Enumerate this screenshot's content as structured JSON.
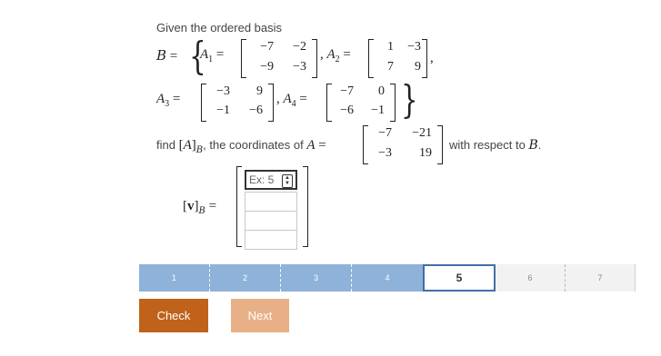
{
  "question": {
    "intro": "Given the ordered basis",
    "find_text": "find",
    "coords_text": ", the coordinates of",
    "wrt_text": "with respect to",
    "basis_symbol": "B",
    "matrices": {
      "A1": [
        [
          "−7",
          "−2"
        ],
        [
          "−9",
          "−3"
        ]
      ],
      "A2": [
        [
          "1",
          "−3"
        ],
        [
          "7",
          "9"
        ]
      ],
      "A3": [
        [
          "−3",
          "9"
        ],
        [
          "−1",
          "−6"
        ]
      ],
      "A4": [
        [
          "−7",
          "0"
        ],
        [
          "−6",
          "−1"
        ]
      ],
      "A": [
        [
          "−7",
          "−21"
        ],
        [
          "−3",
          "19"
        ]
      ]
    }
  },
  "answer": {
    "placeholder": "Ex: 5"
  },
  "progress": {
    "steps": [
      "1",
      "2",
      "3",
      "4",
      "5",
      "6",
      "7"
    ],
    "current": 5
  },
  "buttons": {
    "check": "Check",
    "next": "Next"
  }
}
